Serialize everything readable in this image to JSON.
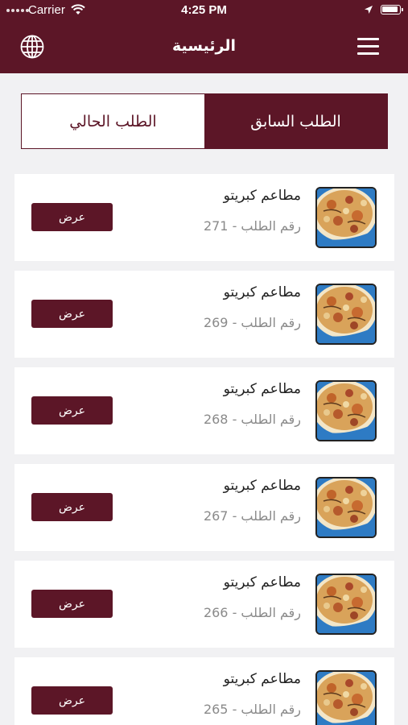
{
  "status_bar": {
    "carrier": "Carrier",
    "time": "4:25 PM"
  },
  "nav": {
    "title": "الرئيسية",
    "language_icon": "globe-icon",
    "menu_icon": "hamburger-menu-icon"
  },
  "tabs": {
    "current": "الطلب الحالي",
    "previous": "الطلب السابق",
    "selected": "previous"
  },
  "colors": {
    "primary": "#5c1627",
    "background": "#f1f1f3",
    "card": "#ffffff",
    "muted_text": "#8a8a8a"
  },
  "orders": [
    {
      "restaurant": "مطاعم كبريتو",
      "order_number": "رقم الطلب - 271",
      "button": "عرض"
    },
    {
      "restaurant": "مطاعم كبريتو",
      "order_number": "رقم الطلب - 269",
      "button": "عرض"
    },
    {
      "restaurant": "مطاعم كبريتو",
      "order_number": "رقم الطلب - 268",
      "button": "عرض"
    },
    {
      "restaurant": "مطاعم كبريتو",
      "order_number": "رقم الطلب - 267",
      "button": "عرض"
    },
    {
      "restaurant": "مطاعم كبريتو",
      "order_number": "رقم الطلب - 266",
      "button": "عرض"
    },
    {
      "restaurant": "مطاعم كبريتو",
      "order_number": "رقم الطلب - 265",
      "button": "عرض"
    }
  ]
}
